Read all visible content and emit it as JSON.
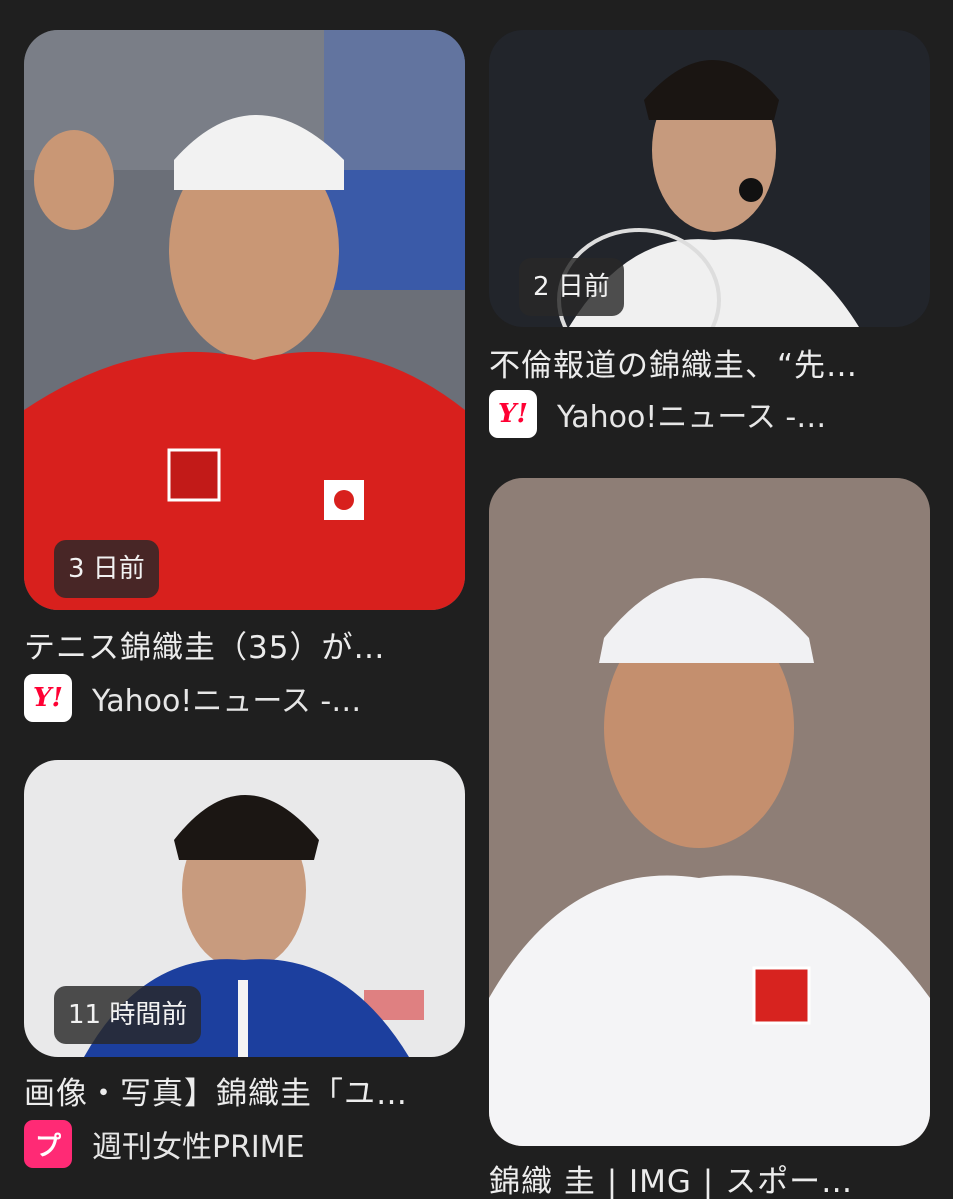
{
  "results": [
    {
      "badge": "3 日前",
      "title": "テニス錦織圭（35）が…",
      "source_icon": "Y!",
      "source": "Yahoo!ニュース -…"
    },
    {
      "badge": "2 日前",
      "title": "不倫報道の錦織圭、“先…",
      "source_icon": "Y!",
      "source": "Yahoo!ニュース -…"
    },
    {
      "badge": "11 時間前",
      "title": "画像・写真】錦織圭「ユ…",
      "source_icon": "プ",
      "source": "週刊女性PRIME"
    },
    {
      "title": "錦織 圭 | IMG | スポー…"
    }
  ],
  "colors": {
    "background": "#1f1f1f",
    "yahoo_red": "#ff0033",
    "prime_pink": "#ff2a75"
  },
  "icons": [
    "yahoo-news-icon",
    "shukan-josei-prime-icon"
  ]
}
